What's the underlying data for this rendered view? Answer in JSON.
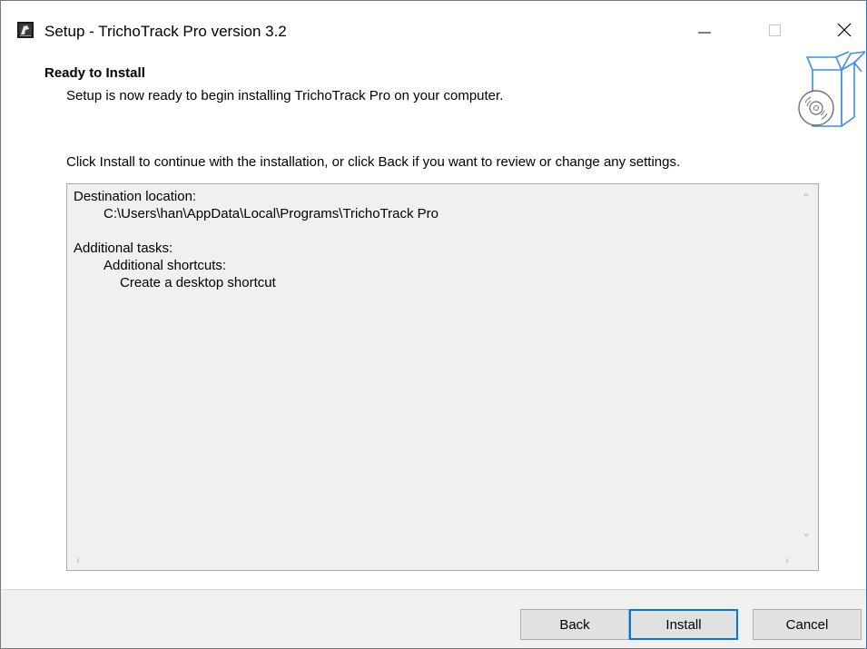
{
  "window": {
    "title": "Setup - TrichoTrack Pro version 3.2",
    "icon": "app-icon",
    "controls": {
      "minimize": "minimize-icon",
      "maximize": "maximize-icon",
      "close": "close-icon"
    }
  },
  "header": {
    "title": "Ready to Install",
    "subtitle": "Setup is now ready to begin installing TrichoTrack Pro on your computer.",
    "image": "install-box-icon"
  },
  "body": {
    "instruction": "Click Install to continue with the installation, or click Back if you want to review or change any settings.",
    "memo": {
      "lines": [
        "Destination location:",
        "C:\\Users\\han\\AppData\\Local\\Programs\\TrichoTrack Pro",
        "",
        "Additional tasks:",
        "Additional shortcuts:",
        "Create a desktop shortcut"
      ]
    }
  },
  "buttons": {
    "back": "Back",
    "install": "Install",
    "cancel": "Cancel"
  },
  "colors": {
    "accent": "#0078d7",
    "footer_bg": "#f0f0f0",
    "memo_bg": "#f0f0f0",
    "icon_blue": "#3a8ee6"
  }
}
